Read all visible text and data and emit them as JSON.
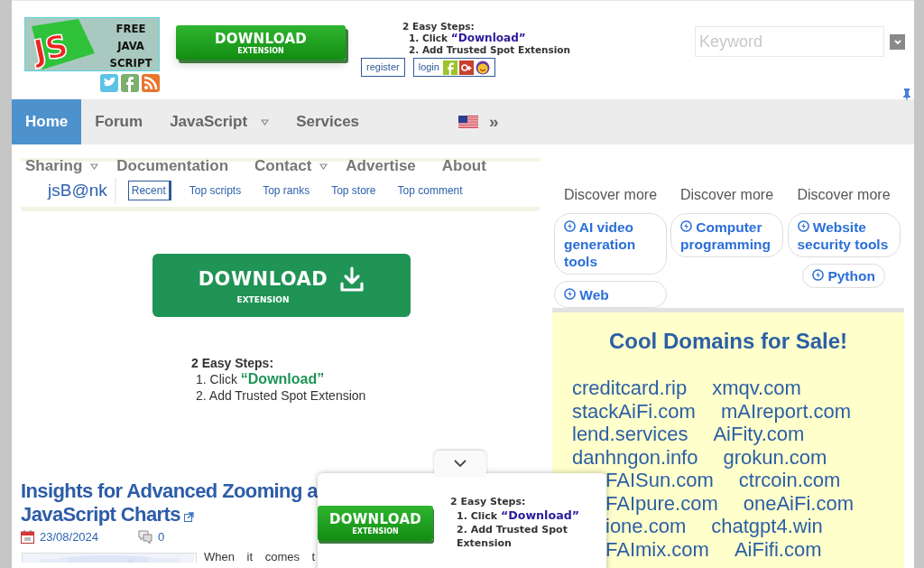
{
  "logo": {
    "badge": "JS",
    "lines": [
      "FREE",
      "JAVA",
      "SCRIPT"
    ]
  },
  "social_links": [
    {
      "kind": "twitter"
    },
    {
      "kind": "facebook"
    },
    {
      "kind": "rss"
    }
  ],
  "header_download": {
    "label": "DOWNLOAD",
    "sublabel": "EXTENSION"
  },
  "header_steps": {
    "title": "2 Easy Steps:",
    "steps": [
      {
        "number": "1.",
        "text": "Click ",
        "highlight": "“Download”"
      },
      {
        "number": "2.",
        "text": "Add Trusted Spot Extension"
      }
    ]
  },
  "account_links": [
    {
      "label": "register",
      "kind": "register"
    },
    {
      "label": "login",
      "kind": "login"
    }
  ],
  "search": {
    "placeholder": "Keyword"
  },
  "main_nav": [
    {
      "label": "Home",
      "selected": true,
      "dropdown": false
    },
    {
      "label": "Forum",
      "selected": false,
      "dropdown": false
    },
    {
      "label": "JavaScript",
      "selected": false,
      "dropdown": true
    },
    {
      "label": "Services",
      "selected": false,
      "dropdown": false
    }
  ],
  "language": {
    "symbol": "»"
  },
  "secondary_nav": [
    {
      "label": "Sharing",
      "dropdown": true
    },
    {
      "label": "Documentation",
      "dropdown": false
    },
    {
      "label": "Contact",
      "dropdown": true
    },
    {
      "label": "Advertise",
      "dropdown": false
    },
    {
      "label": "About",
      "dropdown": false
    }
  ],
  "section_title": "jsB@nk",
  "section_tabs": [
    {
      "label": "Recent",
      "selected": true
    },
    {
      "label": "Top scripts",
      "selected": false
    },
    {
      "label": "Top ranks",
      "selected": false
    },
    {
      "label": "Top store",
      "selected": false
    },
    {
      "label": "Top comment",
      "selected": false
    }
  ],
  "main_download": {
    "label": "DOWNLOAD",
    "sublabel": "EXTENSION"
  },
  "main_steps": {
    "title": "2 Easy Steps:",
    "steps": [
      {
        "number": "1.",
        "text": "Click ",
        "highlight": "“Download”"
      },
      {
        "number": "2.",
        "text": "Add Trusted Spot Extension"
      }
    ]
  },
  "article": {
    "title_lines": [
      "Insights for Advanced Zooming a",
      "JavaScript Charts"
    ],
    "date": "23/08/2024",
    "comments": "0",
    "excerpt": "When it comes t"
  },
  "discover": [
    {
      "heading": "Discover more",
      "chips": [
        "AI video generation tools",
        "Web"
      ]
    },
    {
      "heading": "Discover more",
      "chips": [
        "Computer programming"
      ]
    },
    {
      "heading": "Discover more",
      "chips": [
        "Website security tools",
        "Python"
      ]
    }
  ],
  "domains": {
    "title": "Cool Domains for Sale!",
    "rows": [
      {
        "left": "creditcard.rip",
        "right": "xmqv.com",
        "covered": false
      },
      {
        "left": "stackAiFi.com",
        "right": "mAIreport.com",
        "covered": false
      },
      {
        "left": "lend.services",
        "right": "AiFity.com",
        "covered": false
      },
      {
        "left": "danhngon.info",
        "right": "grokun.com",
        "covered": false
      },
      {
        "left": "FAISun.com",
        "right": "ctrcoin.com",
        "covered": true
      },
      {
        "left": "FAIpure.com",
        "right": "oneAiFi.com",
        "covered": true
      },
      {
        "left": "ione.com",
        "right": "chatgpt4.win",
        "covered": true
      },
      {
        "left": "FAImix.com",
        "right": "AiFifi.com",
        "covered": true
      }
    ]
  },
  "popup": {
    "download": {
      "label": "DOWNLOAD",
      "sublabel": "EXTENSION"
    },
    "steps": {
      "title": "2 Easy Steps:",
      "steps": [
        {
          "number": "1.",
          "text": "Click ",
          "highlight": "“Download”"
        },
        {
          "number": "2.",
          "text": "Add Trusted Spot Extension"
        }
      ]
    }
  }
}
